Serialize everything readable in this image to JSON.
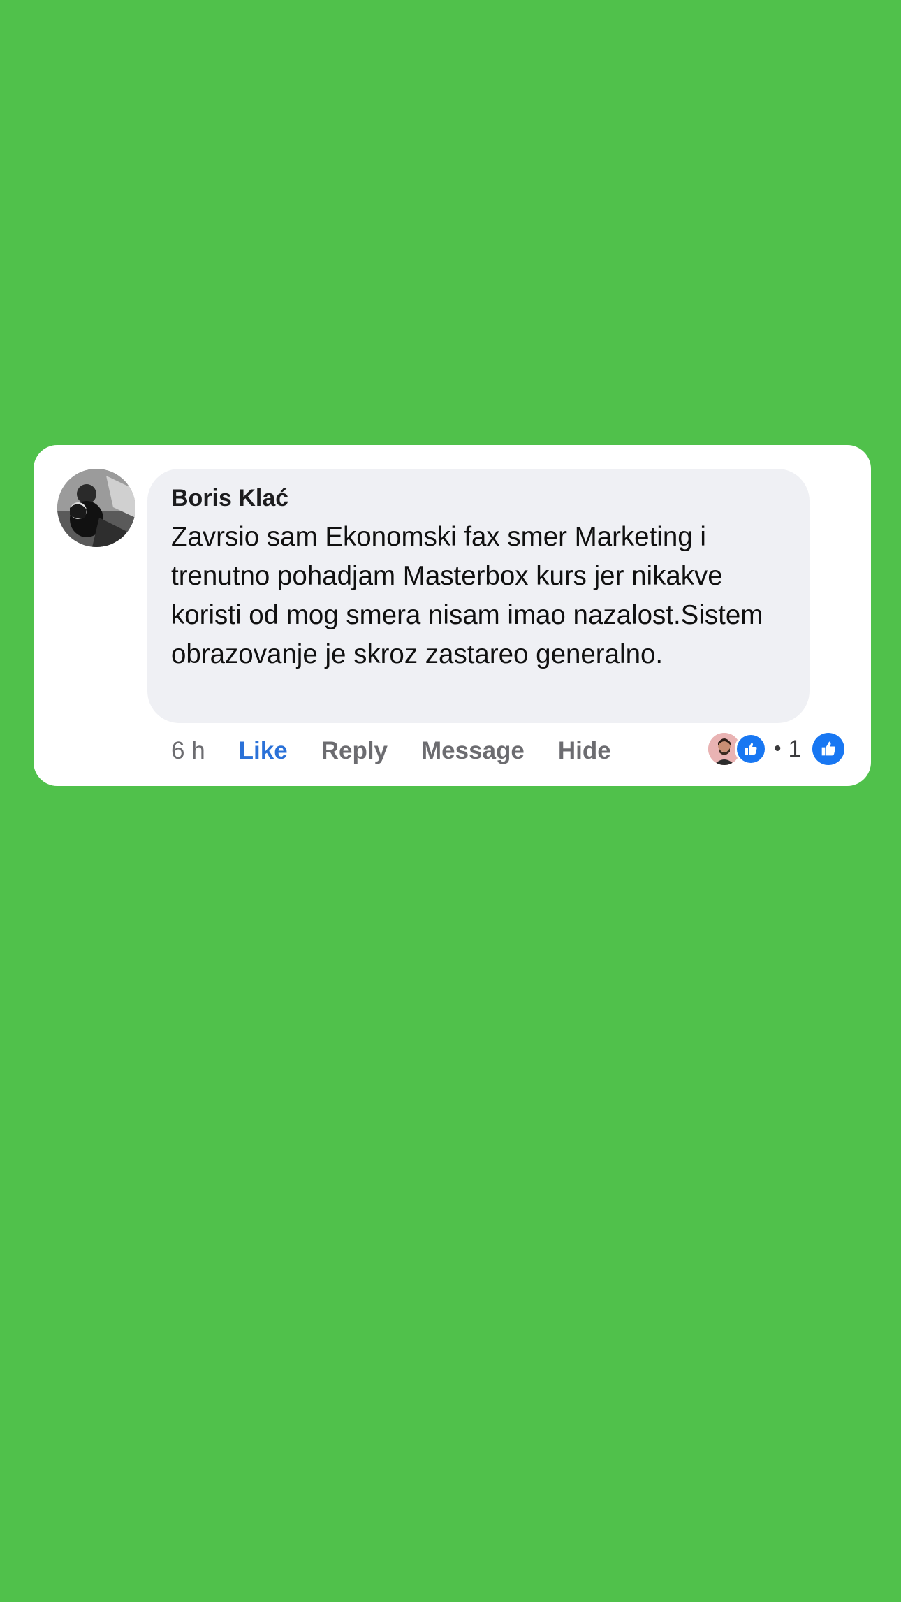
{
  "comment": {
    "author": "Boris Klać",
    "text": "Zavrsio sam Ekonomski fax smer Marketing i trenutno pohadjam Masterbox kurs jer nikakve koristi od mog smera nisam imao nazalost.Sistem obrazovanje je skroz zastareo generalno.",
    "time": "6 h",
    "actions": {
      "like": "Like",
      "reply": "Reply",
      "message": "Message",
      "hide": "Hide"
    },
    "reactions": {
      "separator": "•",
      "count": "1",
      "icon": "thumbs-up-icon"
    }
  },
  "colors": {
    "background": "#50c14b",
    "card": "#ffffff",
    "bubble": "#eff0f4",
    "like_blue": "#2a71d8",
    "reaction_blue": "#1877f2",
    "muted_text": "#6c6c70"
  }
}
